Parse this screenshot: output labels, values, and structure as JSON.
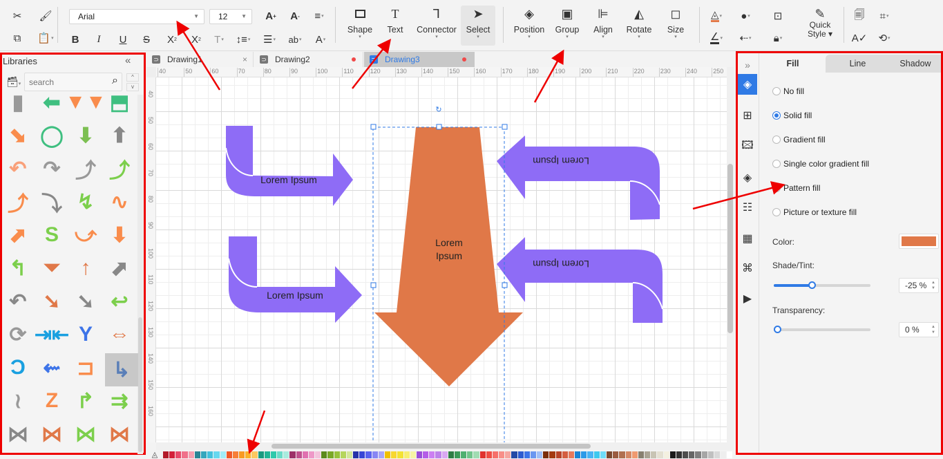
{
  "toolbar": {
    "font_family": "Arial",
    "font_size": "12",
    "big_buttons": [
      {
        "label": "Shape",
        "icon": "rectangle-icon"
      },
      {
        "label": "Text",
        "icon": "text-icon"
      },
      {
        "label": "Connector",
        "icon": "connector-icon"
      },
      {
        "label": "Select",
        "icon": "select-cursor-icon"
      },
      {
        "label": "Position",
        "icon": "layers-icon"
      },
      {
        "label": "Group",
        "icon": "group-icon"
      },
      {
        "label": "Align",
        "icon": "align-left-icon"
      },
      {
        "label": "Rotate",
        "icon": "flip-icon"
      },
      {
        "label": "Size",
        "icon": "size-icon"
      }
    ],
    "quick_style_line1": "Quick",
    "quick_style_line2": "Style",
    "fill_color_indicator": "#e07848"
  },
  "libraries": {
    "title": "Libraries",
    "search_placeholder": "search"
  },
  "tabs": [
    {
      "label": "Drawing1",
      "active": false,
      "modified": false
    },
    {
      "label": "Drawing2",
      "active": false,
      "modified": true
    },
    {
      "label": "Drawing3",
      "active": true,
      "modified": true
    }
  ],
  "ruler": {
    "horizontal": [
      "40",
      "50",
      "60",
      "70",
      "80",
      "90",
      "100",
      "110",
      "120",
      "130",
      "140",
      "150",
      "160",
      "170",
      "180",
      "190",
      "200",
      "210",
      "220",
      "230",
      "240",
      "250"
    ],
    "vertical": [
      "40",
      "50",
      "60",
      "70",
      "80",
      "90",
      "100",
      "110",
      "120",
      "130",
      "140",
      "150",
      "160"
    ]
  },
  "canvas": {
    "shapes": [
      {
        "text": "Lorem Ipsum",
        "color": "#8e6cf6",
        "direction": "right"
      },
      {
        "text": "Lorem Ipsum",
        "color": "#8e6cf6",
        "direction": "right"
      },
      {
        "text": "Lorem Ipsum",
        "color": "#8e6cf6",
        "direction": "left-flipped"
      },
      {
        "text": "Lorem Ipsum",
        "color": "#8e6cf6",
        "direction": "left-flipped"
      },
      {
        "text_line1": "Lorem",
        "text_line2": "Ipsum",
        "color": "#e07848",
        "direction": "down",
        "selected": true
      }
    ]
  },
  "palette": [
    "#b31b2a",
    "#d3203a",
    "#e84a6a",
    "#f0708a",
    "#f59fb0",
    "#2a8595",
    "#35a7bd",
    "#44c1dc",
    "#67d8ef",
    "#a3ecf7",
    "#f05a28",
    "#f77e37",
    "#f99a22",
    "#fbb12a",
    "#fcc860",
    "#1a9a80",
    "#22b596",
    "#2fc9ab",
    "#6bdbc8",
    "#a8ebde",
    "#9c3068",
    "#c0518e",
    "#e071b0",
    "#ee99c8",
    "#f3c3dc",
    "#5c8a1c",
    "#7aa828",
    "#98c23d",
    "#b5d55d",
    "#d3e79a",
    "#2733a8",
    "#3846d6",
    "#5a62ef",
    "#8886f4",
    "#a9a6f7",
    "#f0c000",
    "#f7d731",
    "#f3e234",
    "#f7ee70",
    "#f5f3a5",
    "#9a4fd8",
    "#b45ee8",
    "#cc7ff2",
    "#be82ea",
    "#d9a8f2",
    "#2e7d44",
    "#3c9a58",
    "#4fb070",
    "#71c48b",
    "#a0dcb2",
    "#e0332e",
    "#f04f45",
    "#f6706a",
    "#f88f88",
    "#f6a6a0",
    "#234aa6",
    "#2d5cd0",
    "#3d74e8",
    "#6a97f0",
    "#a0bff7",
    "#7a2e0a",
    "#a33a10",
    "#b94428",
    "#d45e40",
    "#e57a5c",
    "#1a84d4",
    "#2c9ae8",
    "#49b4f4",
    "#3ec9ef",
    "#6fdcf8",
    "#7a4a30",
    "#9a5c40",
    "#b07050",
    "#d48864",
    "#f09a70",
    "#888070",
    "#aaa494",
    "#c8c4b4",
    "#e4e0d2",
    "#f4f0e0",
    "#1a1a1a",
    "#333333",
    "#4d4d4d",
    "#666666",
    "#808080",
    "#a6a6a6",
    "#c0c0c0",
    "#d9d9d9",
    "#eeeeee",
    "#ffffff"
  ],
  "properties": {
    "tabs": [
      "Fill",
      "Line",
      "Shadow"
    ],
    "active_tab": "Fill",
    "fill_options": [
      {
        "label": "No fill",
        "checked": false
      },
      {
        "label": "Solid fill",
        "checked": true
      },
      {
        "label": "Gradient fill",
        "checked": false
      },
      {
        "label": "Single color gradient fill",
        "checked": false
      },
      {
        "label": "Pattern fill",
        "checked": false
      },
      {
        "label": "Picture or texture fill",
        "checked": false
      }
    ],
    "color_label": "Color:",
    "color_value": "#e07848",
    "shade_label": "Shade/Tint:",
    "shade_value": "-25 %",
    "shade_fraction": 0.39,
    "transparency_label": "Transparency:",
    "transparency_value": "0 %",
    "transparency_fraction": 0.0
  }
}
